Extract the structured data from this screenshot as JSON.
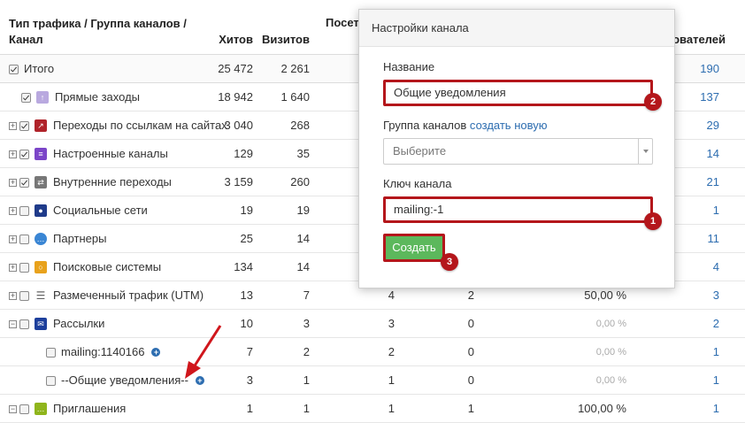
{
  "table": {
    "headers": {
      "name": "Тип трафика / Группа каналов / Канал",
      "hits": "Хитов",
      "visits": "Визитов",
      "visitors_partial": "Посет",
      "users_partial": "ователей"
    },
    "rows": [
      {
        "name": "Итого",
        "hits": "25 472",
        "visits": "2 261",
        "last": "190"
      },
      {
        "name": "Прямые заходы",
        "hits": "18 942",
        "visits": "1 640",
        "last": "137"
      },
      {
        "name": "Переходы по ссылкам на сайтах",
        "hits": "3 040",
        "visits": "268",
        "last": "29"
      },
      {
        "name": "Настроенные каналы",
        "hits": "129",
        "visits": "35",
        "last": "14"
      },
      {
        "name": "Внутренние переходы",
        "hits": "3 159",
        "visits": "260",
        "last": "21"
      },
      {
        "name": "Социальные сети",
        "hits": "19",
        "visits": "19",
        "last": "1"
      },
      {
        "name": "Партнеры",
        "hits": "25",
        "visits": "14",
        "last": "11"
      },
      {
        "name": "Поисковые системы",
        "hits": "134",
        "visits": "14",
        "last": "4"
      },
      {
        "name": "Размеченный трафик (UTM)",
        "hits": "13",
        "visits": "7",
        "c3": "4",
        "c4": "2",
        "pct": "50,00 %",
        "last": "3"
      },
      {
        "name": "Рассылки",
        "hits": "10",
        "visits": "3",
        "c3": "3",
        "c4": "0",
        "pct": "0,00 %",
        "last": "2"
      },
      {
        "name": "mailing:1140166",
        "hits": "7",
        "visits": "2",
        "c3": "2",
        "c4": "0",
        "pct": "0,00 %",
        "last": "1"
      },
      {
        "name": "--Общие уведомления--",
        "hits": "3",
        "visits": "1",
        "c3": "1",
        "c4": "0",
        "pct": "0,00 %",
        "last": "1"
      },
      {
        "name": "Приглашения",
        "hits": "1",
        "visits": "1",
        "c3": "1",
        "c4": "1",
        "pct": "100,00 %",
        "last": "1"
      }
    ]
  },
  "modal": {
    "title": "Настройки канала",
    "name_label": "Название",
    "name_value": "Общие уведомления",
    "group_label": "Группа каналов",
    "group_create_link": "создать новую",
    "group_placeholder": "Выберите",
    "key_label": "Ключ канала",
    "key_value": "mailing:-1",
    "create_button": "Создать"
  },
  "markers": {
    "m1": "1",
    "m2": "2",
    "m3": "3"
  },
  "colors": {
    "highlight_red": "#b4161b",
    "create_green": "#5cb85c",
    "link_blue": "#2d6db0"
  }
}
